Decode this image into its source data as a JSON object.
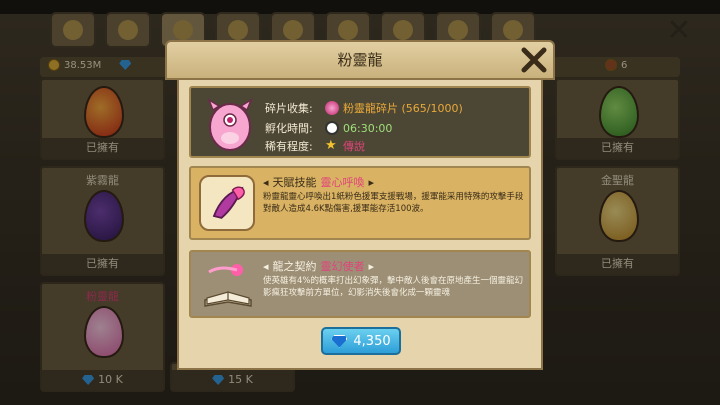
{
  "background": {
    "resources": {
      "coins": "38.53M",
      "counter": "6"
    },
    "slots": [
      {
        "name": "",
        "status": "已擁有",
        "egg": "fire-egg"
      },
      {
        "name": "",
        "status": "已擁有",
        "egg": "green-egg"
      },
      {
        "name": "紫霧龍",
        "status": "已擁有",
        "egg": "purple-egg"
      },
      {
        "name": "金聖龍",
        "status": "已擁有",
        "egg": "gold-egg"
      },
      {
        "name": "粉靈龍",
        "status": "",
        "cost": "10 K",
        "egg": "pink-egg"
      },
      {
        "cost": "15 K"
      }
    ]
  },
  "dialog": {
    "title": "粉靈龍",
    "info": {
      "fragment_label": "碎片收集:",
      "fragment_value": "粉靈龍碎片 (565/1000)",
      "hatch_label": "孵化時間:",
      "hatch_value": "06:30:00",
      "rarity_label": "稀有程度:",
      "rarity_value": "傳說"
    },
    "talent": {
      "header": "天賦技能",
      "name": "靈心呼喚",
      "description": "粉靈龍靈心呼喚出1紙粉色援軍支援戰場，援軍能采用特殊的攻擊手段對敵人造成4.6K點傷害,援軍能存活100波。"
    },
    "contract": {
      "header": "龍之契約",
      "name": "靈幻使者",
      "description": "使英雄有4%的概率打出幻象彈，擊中敵人後會在原地產生一個靈龍幻影瘋狂攻擊前方單位，幻影消失後會化成一顆靈魂"
    },
    "buy_price": "4,350"
  },
  "colors": {
    "accent_pink": "#e0447a",
    "gem_blue": "#2d9ed8",
    "gold": "#e9a93a"
  }
}
